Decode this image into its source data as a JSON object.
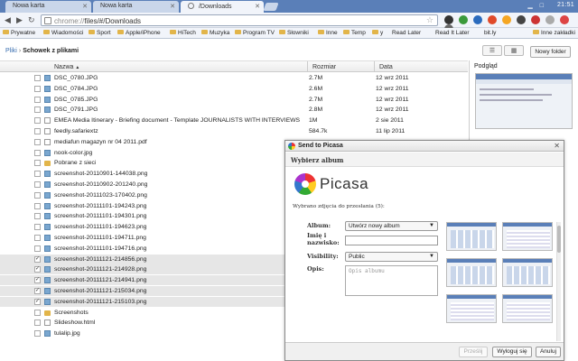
{
  "browser": {
    "tabs": [
      {
        "label": "Nowa karta"
      },
      {
        "label": "Nowa karta"
      },
      {
        "label": "/Downloads"
      }
    ],
    "clock": "21:51",
    "url_prefix": "chrome://",
    "url_main": "files/#/Downloads",
    "bookmarks": [
      "Prywatne",
      "Wiadomości",
      "Sport",
      "Apple/iPhone",
      "HiTech",
      "Muzyka",
      "Program TV",
      "Słowniki",
      "Inne",
      "Temp",
      "y",
      "Read Later",
      "Read It Later",
      "bit.ly",
      "Inne zakładki"
    ]
  },
  "filemanager": {
    "crumb_root": "Pliki",
    "crumb_sep": "›",
    "crumb_current": "Schowek z plikami",
    "new_folder": "Nowy folder",
    "columns": {
      "name": "Nazwa",
      "size": "Rozmiar",
      "date": "Data"
    },
    "sort_indicator": "▲",
    "preview_title": "Podgląd",
    "rows": [
      {
        "name": "DSC_0780.JPG",
        "size": "2.7M",
        "date": "12 wrz 2011",
        "icon": "image",
        "checked": false
      },
      {
        "name": "DSC_0784.JPG",
        "size": "2.6M",
        "date": "12 wrz 2011",
        "icon": "image",
        "checked": false
      },
      {
        "name": "DSC_0785.JPG",
        "size": "2.7M",
        "date": "12 wrz 2011",
        "icon": "image",
        "checked": false
      },
      {
        "name": "DSC_0791.JPG",
        "size": "2.8M",
        "date": "12 wrz 2011",
        "icon": "image",
        "checked": false
      },
      {
        "name": "EMEA Media Itinerary - Briefing document - Template JOURNALISTS WITH INTERVIEWS...",
        "size": "1M",
        "date": "2 sie 2011",
        "icon": "doc",
        "checked": false
      },
      {
        "name": "feedly.safariextz",
        "size": "584.7k",
        "date": "11 lip 2011",
        "icon": "doc",
        "checked": false
      },
      {
        "name": "mediafun magazyn nr 04 2011.pdf",
        "size": "",
        "date": "",
        "icon": "doc",
        "checked": false
      },
      {
        "name": "nook-color.jpg",
        "size": "",
        "date": "",
        "icon": "image",
        "checked": false
      },
      {
        "name": "Pobrane z sieci",
        "size": "",
        "date": "",
        "icon": "folder",
        "checked": false
      },
      {
        "name": "screenshot-20110901-144038.png",
        "size": "",
        "date": "",
        "icon": "image",
        "checked": false
      },
      {
        "name": "screenshot-20110902-201240.png",
        "size": "",
        "date": "",
        "icon": "image",
        "checked": false
      },
      {
        "name": "screenshot-20111023-170402.png",
        "size": "",
        "date": "",
        "icon": "image",
        "checked": false
      },
      {
        "name": "screenshot-20111101-194243.png",
        "size": "",
        "date": "",
        "icon": "image",
        "checked": false
      },
      {
        "name": "screenshot-20111101-194301.png",
        "size": "",
        "date": "",
        "icon": "image",
        "checked": false
      },
      {
        "name": "screenshot-20111101-194623.png",
        "size": "",
        "date": "",
        "icon": "image",
        "checked": false
      },
      {
        "name": "screenshot-20111101-194711.png",
        "size": "",
        "date": "",
        "icon": "image",
        "checked": false
      },
      {
        "name": "screenshot-20111101-194716.png",
        "size": "",
        "date": "",
        "icon": "image",
        "checked": false
      },
      {
        "name": "screenshot-20111121-214856.png",
        "size": "",
        "date": "",
        "icon": "image",
        "checked": true
      },
      {
        "name": "screenshot-20111121-214928.png",
        "size": "",
        "date": "",
        "icon": "image",
        "checked": true
      },
      {
        "name": "screenshot-20111121-214941.png",
        "size": "",
        "date": "",
        "icon": "image",
        "checked": true
      },
      {
        "name": "screenshot-20111121-215034.png",
        "size": "",
        "date": "",
        "icon": "image",
        "checked": true
      },
      {
        "name": "screenshot-20111121-215103.png",
        "size": "",
        "date": "",
        "icon": "image",
        "checked": true
      },
      {
        "name": "Screenshots",
        "size": "",
        "date": "",
        "icon": "folder",
        "checked": false
      },
      {
        "name": "Slideshow.html",
        "size": "",
        "date": "",
        "icon": "doc",
        "checked": false
      },
      {
        "name": "tulalip.jpg",
        "size": "",
        "date": "",
        "icon": "image",
        "checked": false
      }
    ]
  },
  "dialog": {
    "title": "Send to Picasa",
    "subheader": "Wybierz album",
    "logo_text": "Picasa",
    "selected_info": "Wybrano zdjęcia do przesłania (5):",
    "album_label": "Album:",
    "album_value": "Utwórz nowy album",
    "name_label_1": "Imię i",
    "name_label_2": "nazwisko:",
    "visibility_label": "Visibility:",
    "visibility_value": "Public",
    "description_label": "Opis:",
    "description_placeholder": "Opis albumu",
    "btn_upload": "Prześlij",
    "btn_logout": "Wyloguj się",
    "btn_cancel": "Anuluj"
  },
  "colors": {
    "tabstrip": "#5a7fb8",
    "link": "#3a6fb0",
    "selected_row": "#e6e6e6"
  }
}
